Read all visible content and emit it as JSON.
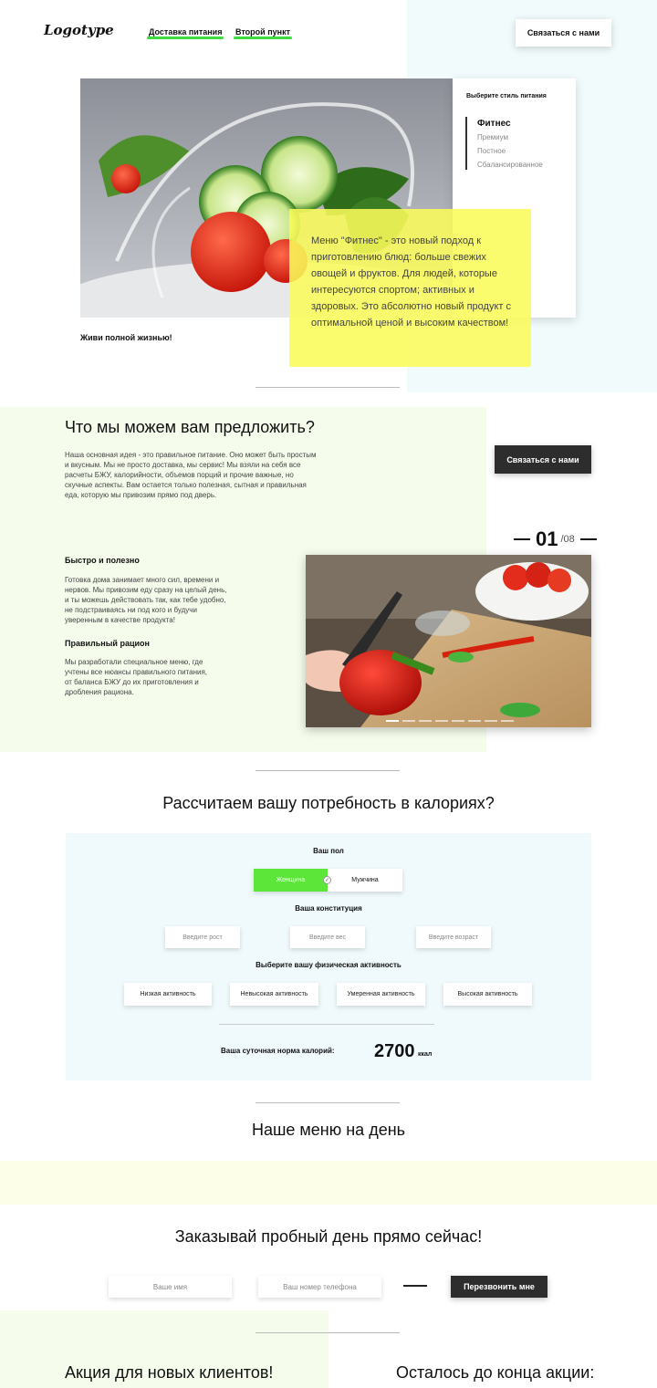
{
  "header": {
    "logo": "Logotype",
    "nav": [
      "Доставка питания",
      "Второй пункт"
    ],
    "contact_button": "Связаться с нами"
  },
  "hero": {
    "panel_title": "Выберите стиль питания",
    "styles": [
      "Фитнес",
      "Премиум",
      "Постное",
      "Сбалансированное"
    ],
    "active_style": "Фитнес",
    "description": "Меню \"Фитнес\" - это новый подход к приготовлению блюд: больше свежих овощей и фруктов. Для людей, которые интересуются спортом; активных и здоровых. Это абсолютно новый продукт с оптимальной ценой и высоким качеством!",
    "slogan": "Живи полной жизнью!"
  },
  "offer": {
    "title": "Что мы можем вам предложить?",
    "text": "Наша основная идея - это правильное питание. Оно может быть простым и вкусным. Мы не просто доставка, мы сервис! Мы взяли на себя все расчеты БЖУ, калорийности, объемов порций и прочие важные, но скучные аспекты. Вам остается только полезная, сытная и правильная еда, которую мы привозим прямо под дверь.",
    "contact_button": "Связаться с нами",
    "counter_current": "01",
    "counter_total": "/08",
    "block1_title": "Быстро и полезно",
    "block1_text": "Готовка дома занимает много сил, времени и нервов. Мы привозим еду сразу на целый день, и ты можешь действовать так, как тебе удобно, не подстраиваясь ни под кого и будучи уверенным в качестве продукта!",
    "block2_title": "Правильный рацион",
    "block2_text": "Мы разработали специальное меню, где учтены все нюансы правильного питания, от баланса БЖУ до их приготовления и дробления рациона."
  },
  "calculator": {
    "title": "Рассчитаем вашу потребность в калориях?",
    "gender_label": "Ваш пол",
    "gender_options": [
      "Женщина",
      "Мужчина"
    ],
    "gender_selected": "Женщина",
    "constitution_label": "Ваша конституция",
    "inputs": [
      "Введите рост",
      "Введите вес",
      "Введите возраст"
    ],
    "activity_label": "Выберите вашу физическая активность",
    "activities": [
      "Низкая активность",
      "Невысокая активность",
      "Умеренная активность",
      "Высокая активность"
    ],
    "result_label": "Ваша суточная норма калорий:",
    "result_value": "2700",
    "result_unit": "ккал"
  },
  "menu": {
    "title": "Наше меню на день"
  },
  "order": {
    "title": "Заказывай пробный день прямо сейчас!",
    "name_placeholder": "Ваше имя",
    "phone_placeholder": "Ваш номер телефона",
    "submit_button": "Перезвонить мне"
  },
  "promo": {
    "left_title": "Акция для новых клиентов!",
    "right_title": "Осталось до конца акции:"
  },
  "colors": {
    "accent_green": "#3fdc3f",
    "highlight_yellow": "#fafa5a",
    "dark_button": "#2d2d2d"
  }
}
